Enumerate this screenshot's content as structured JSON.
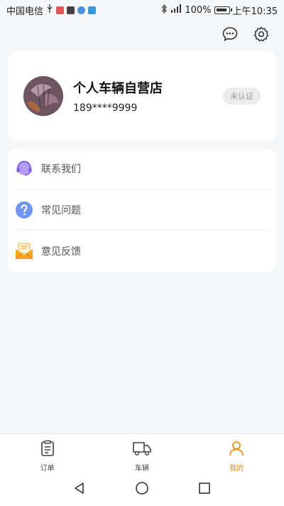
{
  "status_bar": {
    "carrier": "中国电信",
    "battery": "100%",
    "time": "上午10:35"
  },
  "profile": {
    "name": "个人车辆自营店",
    "phone": "189****9999",
    "status": "未认证"
  },
  "menu": [
    {
      "label": "联系我们",
      "icon": "headset-icon"
    },
    {
      "label": "常见问题",
      "icon": "question-icon"
    },
    {
      "label": "意见反馈",
      "icon": "envelope-icon"
    }
  ],
  "tabs": [
    {
      "label": "订单",
      "icon": "clipboard-icon"
    },
    {
      "label": "车辆",
      "icon": "truck-icon"
    },
    {
      "label": "我的",
      "icon": "user-icon",
      "active": true
    }
  ],
  "colors": {
    "accent": "#f08a16",
    "background": "#f5f6f8"
  }
}
